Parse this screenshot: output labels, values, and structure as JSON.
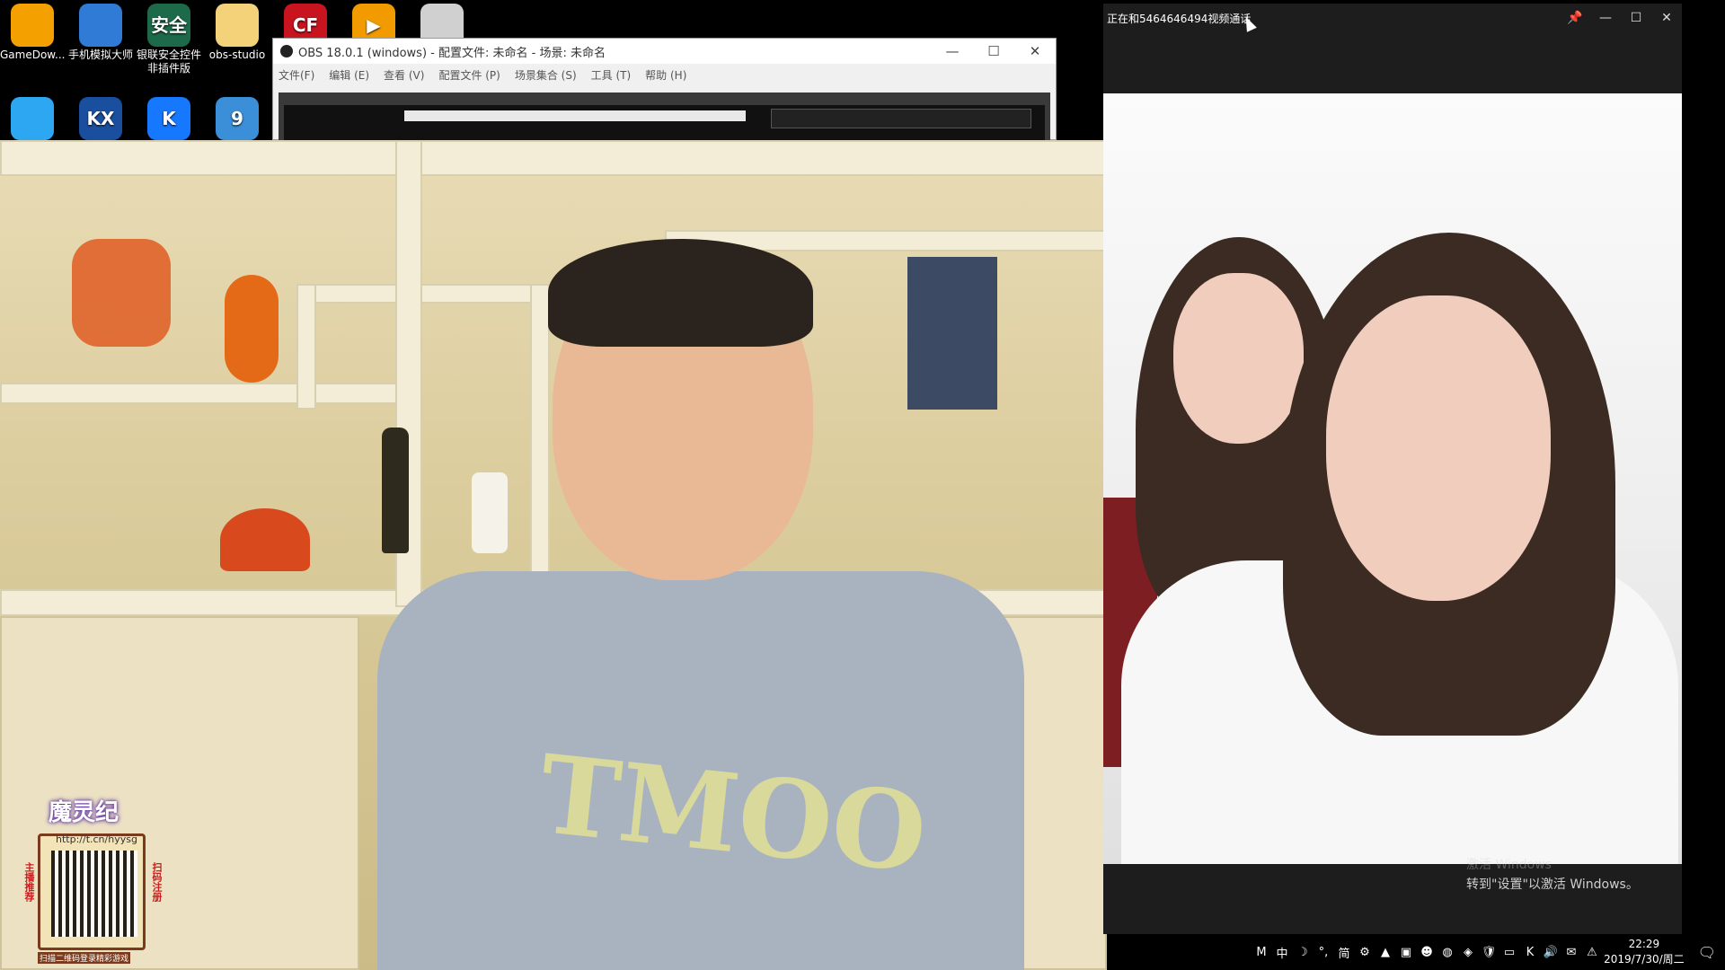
{
  "desktop": {
    "icons": [
      {
        "label": "GameDow...",
        "icon": "gamedownloader-icon",
        "color": "#f4a000"
      },
      {
        "label": "手机模拟大师",
        "icon": "phone-emulator-icon",
        "color": "#2f7bd6"
      },
      {
        "label": "银联安全控件非插件版",
        "icon": "shield-icon",
        "color": "#1d6a4a",
        "glyph": "安全"
      },
      {
        "label": "obs-studio",
        "icon": "folder-icon",
        "color": "#f3d27a"
      },
      {
        "label": "",
        "icon": "crossfire-icon",
        "color": "#c8141e",
        "glyph": "CF"
      },
      {
        "label": "",
        "icon": "video-player-icon",
        "color": "#f29b00",
        "glyph": "▶"
      },
      {
        "label": "",
        "icon": "qr-image-icon",
        "color": "#d0d0d0"
      },
      {
        "label": "",
        "icon": "qq-penguin-icon",
        "color": "#2ea7f2"
      },
      {
        "label": "",
        "icon": "kx-app-icon",
        "color": "#1a4fa0",
        "glyph": "KX"
      },
      {
        "label": "",
        "icon": "kugou-icon",
        "color": "#1677ff",
        "glyph": "K"
      },
      {
        "label": "",
        "icon": "document-icon",
        "color": "#3b8fd9",
        "glyph": "9"
      }
    ]
  },
  "obs": {
    "title": "OBS 18.0.1 (windows) - 配置文件: 未命名 - 场景: 未命名",
    "menu": [
      "文件(F)",
      "编辑 (E)",
      "查看 (V)",
      "配置文件 (P)",
      "场景集合 (S)",
      "工具 (T)",
      "帮助 (H)"
    ],
    "window_buttons": [
      "—",
      "☐",
      "✕"
    ]
  },
  "qr_badge": {
    "title": "魔灵纪",
    "url": "http://t.cn/hyysg",
    "left_text": "主播推荐",
    "right_text": "扫码注册",
    "bottom_text": "扫描二维码登录精彩游戏"
  },
  "webcam": {
    "shirt_print": "TMOO"
  },
  "call_window": {
    "title": "正在和5464646494视频通话",
    "buttons": [
      "📌",
      "—",
      "☐",
      "✕"
    ]
  },
  "watermark": {
    "line1": "激活 Windows",
    "line2": "转到\"设置\"以激活 Windows。"
  },
  "taskbar": {
    "tray": [
      "M",
      "中",
      "☽",
      "°,",
      "简",
      "⚙",
      "▲",
      "▣",
      "☻",
      "◍",
      "◈",
      "🛡",
      "▭",
      "K",
      "🔊",
      "✉",
      "⚠"
    ],
    "time": "22:29",
    "date": "2019/7/30/周二",
    "notification_glyph": "🗨"
  }
}
